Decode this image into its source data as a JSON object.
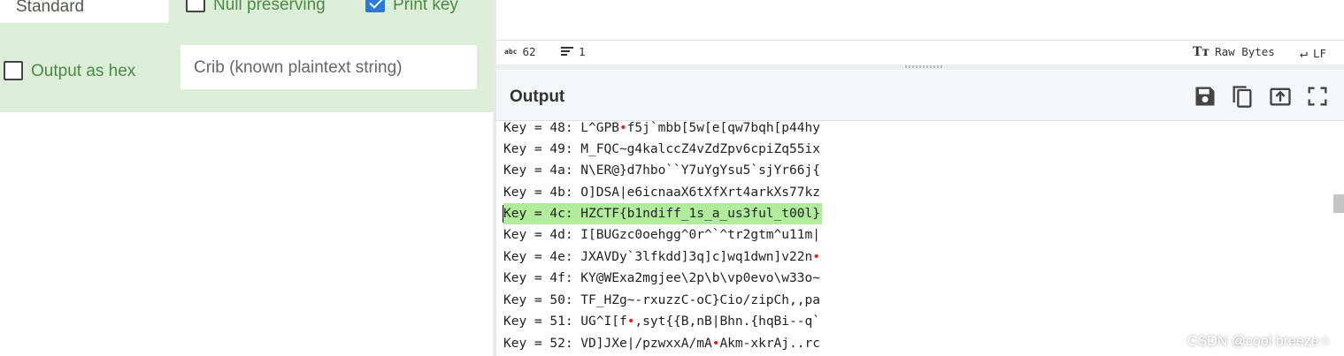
{
  "recipe": {
    "mode_value": "Standard",
    "null_preserving_label": "Null preserving",
    "null_preserving_checked": false,
    "print_key_label": "Print key",
    "print_key_checked": true,
    "output_hex_label": "Output as hex",
    "output_hex_checked": false,
    "crib_placeholder": "Crib (known plaintext string)"
  },
  "status": {
    "chars_icon": "abc",
    "chars": "62",
    "lines": "1",
    "encoding": "Raw Bytes",
    "eol": "LF"
  },
  "output": {
    "title": "Output",
    "buttons": [
      "save-icon",
      "copy-icon",
      "replace-input-icon",
      "maximise-icon"
    ],
    "lines": [
      "Key = 48: L^GPB•f5j`mbb[5w[e[qw7bqh[p44hy",
      "Key = 49: M_FQC~g4kalccZ4vZdZpv6cpiZq55ix",
      "Key = 4a: N\\ER@}d7hbo``Y7uYgYsu5`sjYr66j{",
      "Key = 4b: O]DSA|e6icnaaX6tXfXrt4arkXs77kz",
      "Key = 4c: HZCTF{b1ndiff_1s_a_us3ful_t00l}",
      "Key = 4d: I[BUGzc0oehgg^0r^`^tr2gtm^u11m|",
      "Key = 4e: JXAVDy`3lfkdd]3q]c]wq1dwn]v22n•",
      "Key = 4f: KY@WExa2mgjee\\2p\\b\\vp0evo\\w33o~",
      "Key = 50: TF_HZg~-rxuzzC-oC}Cio/zipCh,,pa",
      "Key = 51: UG^I[f•,syt{{B,nB|Bhn.{hqBi--q`",
      "Key = 52: VD]JXe|/pzwxxA/mA•Akm-xkrAj..rc"
    ],
    "highlighted_index": 4
  },
  "watermark": "CSDN @cool breeze☆",
  "colors": {
    "recipe_bg": "#dcedd8",
    "label_green": "#4b8a43",
    "highlight": "#b1eb9c",
    "checkbox_blue": "#2a7bd6"
  }
}
